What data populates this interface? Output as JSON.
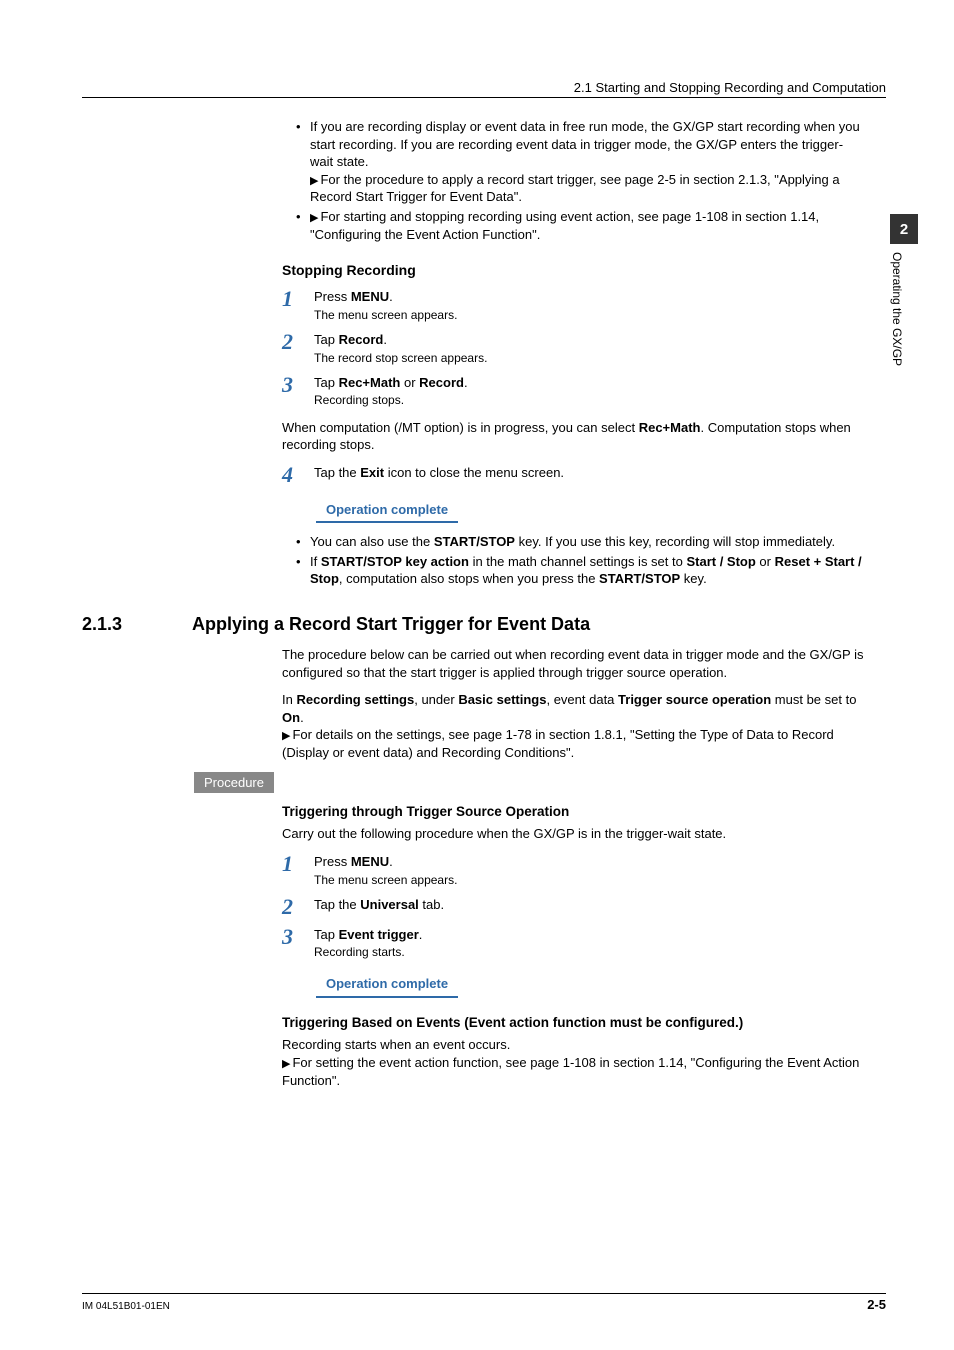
{
  "header": {
    "running_title": "2.1  Starting and Stopping Recording and Computation"
  },
  "side_tab": {
    "chapter_num": "2",
    "chapter_label": "Operating the GX/GP"
  },
  "intro": {
    "bullets": [
      {
        "text_before": "If you are recording display or event data in free run mode, the GX/GP start recording when you start recording. If you are recording event data in trigger mode, the GX/GP enters the trigger-wait state.",
        "refs": [
          "For the procedure to apply a record start trigger, see page 2-5 in section 2.1.3, \"Applying a Record Start Trigger for Event Data\"."
        ]
      },
      {
        "is_ref_only": true,
        "refs": [
          "For starting and stopping recording using event action, see page 1-108 in section 1.14, \"Configuring the Event Action Function\"."
        ]
      }
    ]
  },
  "stopping": {
    "heading": "Stopping Recording",
    "steps": [
      {
        "num": "1",
        "line_pre": "Press ",
        "bold1": "MENU",
        "line_post": ".",
        "note": "The menu screen appears."
      },
      {
        "num": "2",
        "line_pre": "Tap ",
        "bold1": "Record",
        "line_post": ".",
        "note": "The record stop screen appears."
      },
      {
        "num": "3",
        "line_pre": "Tap ",
        "bold1": "Rec+Math",
        "mid": " or ",
        "bold2": "Record",
        "line_post": ".",
        "note": "Recording stops."
      }
    ],
    "mid_para_pre": "When computation (/MT option) is in progress, you can select ",
    "mid_para_bold": "Rec+Math",
    "mid_para_post": ". Computation stops when recording stops.",
    "step4": {
      "num": "4",
      "line_pre": "Tap the ",
      "bold1": "Exit",
      "line_post": " icon to close the menu screen."
    },
    "op_complete": "Operation complete",
    "post_bullets": [
      {
        "pre": "You can also use the ",
        "b1": "START/STOP",
        "post": " key. If you use this key, recording will stop immediately."
      },
      {
        "pre": "If ",
        "b1": "START/STOP key action",
        "mid1": " in the math channel settings is set to ",
        "b2": "Start / Stop",
        "mid2": " or ",
        "b3": "Reset + Start / Stop",
        "mid3": ", computation also stops when you press the ",
        "b4": "START/STOP",
        "post": " key."
      }
    ]
  },
  "section213": {
    "num": "2.1.3",
    "title": "Applying a Record Start Trigger for Event Data",
    "intro1": "The procedure below can be carried out when recording event data in trigger mode and the GX/GP is configured so that the start trigger is applied through trigger source operation.",
    "intro2_pre": "In ",
    "intro2_b1": "Recording settings",
    "intro2_mid1": ", under ",
    "intro2_b2": "Basic settings",
    "intro2_mid2": ", event data ",
    "intro2_b3": "Trigger source operation",
    "intro2_mid3": " must be set to ",
    "intro2_b4": "On",
    "intro2_post": ".",
    "ref": "For details on the settings, see page 1-78 in section 1.8.1, \"Setting the Type of Data to Record (Display or event data) and Recording Conditions\".",
    "proc_label": "Procedure",
    "sub1_heading": "Triggering through Trigger Source Operation",
    "sub1_intro": "Carry out the following procedure when the GX/GP is in the trigger-wait state.",
    "sub1_steps": [
      {
        "num": "1",
        "line_pre": "Press ",
        "bold1": "MENU",
        "line_post": ".",
        "note": "The menu screen appears."
      },
      {
        "num": "2",
        "line_pre": "Tap the ",
        "bold1": "Universal",
        "line_post": " tab."
      },
      {
        "num": "3",
        "line_pre": "Tap ",
        "bold1": "Event trigger",
        "line_post": ".",
        "note": "Recording starts."
      }
    ],
    "op_complete": "Operation complete",
    "sub2_heading": "Triggering Based on Events (Event action function must be configured.)",
    "sub2_line1": "Recording starts when an event occurs.",
    "sub2_ref": "For setting the event action function, see page 1-108 in section 1.14, \"Configuring the Event Action Function\"."
  },
  "footer": {
    "doc_id": "IM 04L51B01-01EN",
    "page": "2-5"
  }
}
